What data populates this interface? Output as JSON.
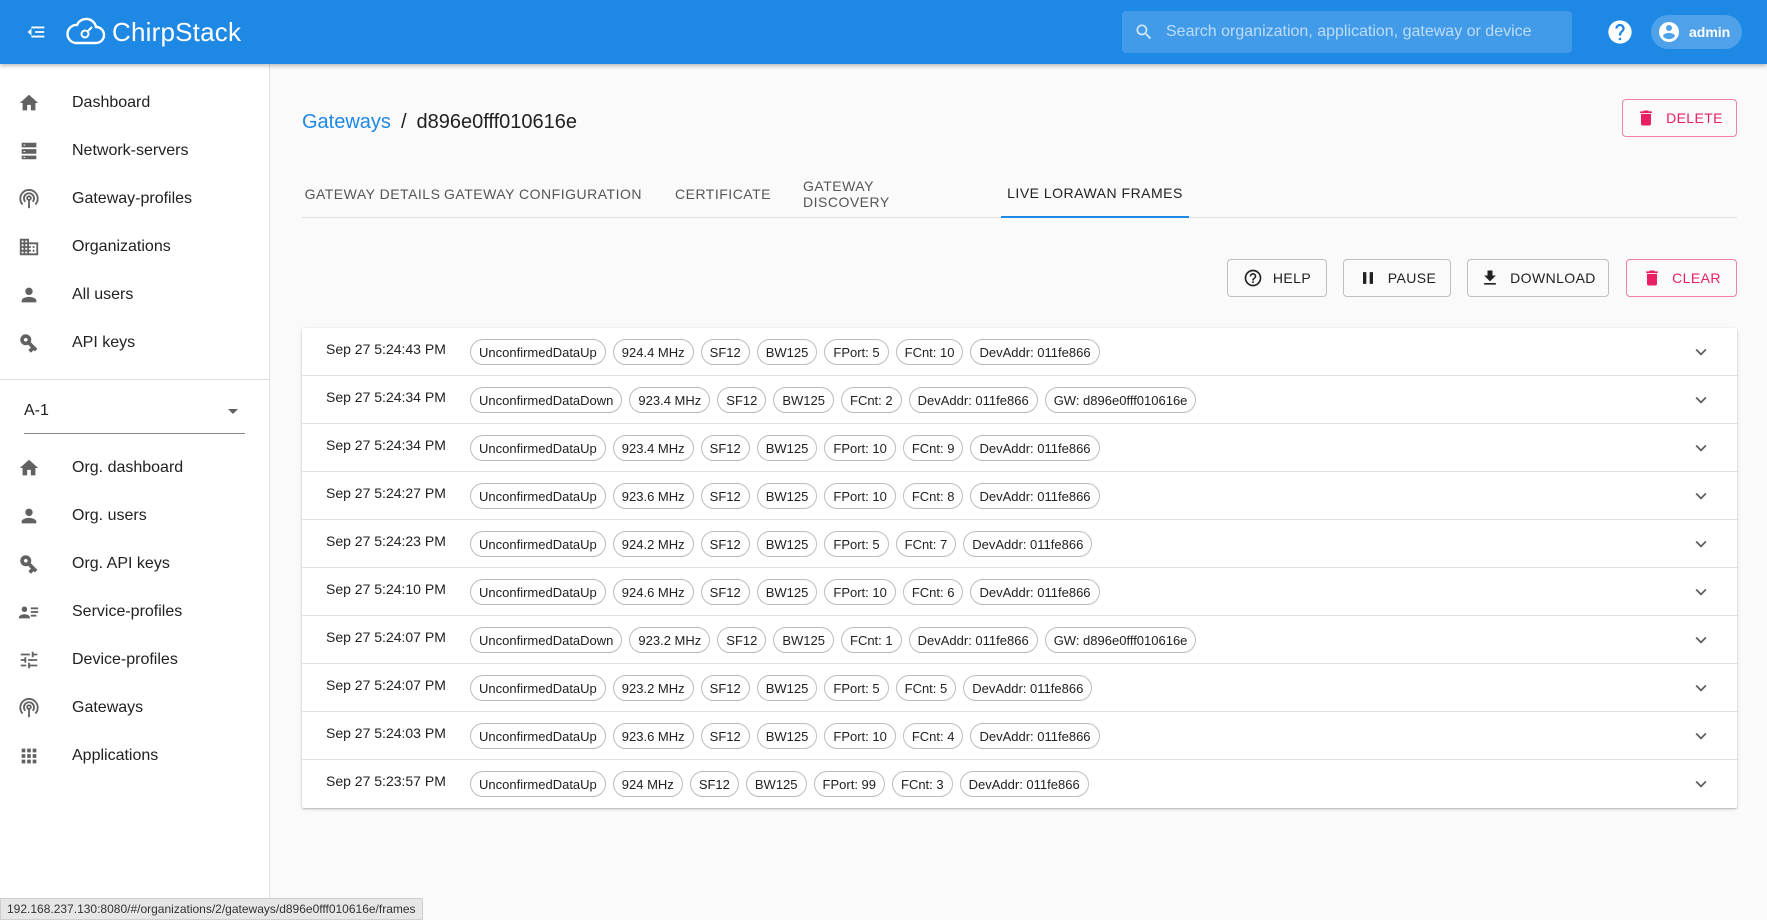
{
  "header": {
    "logo_text": "ChirpStack",
    "search_placeholder": "Search organization, application, gateway or device",
    "user_name": "admin"
  },
  "sidebar": {
    "global_items": [
      {
        "label": "Dashboard",
        "icon": "home-icon"
      },
      {
        "label": "Network-servers",
        "icon": "server-icon"
      },
      {
        "label": "Gateway-profiles",
        "icon": "radio-tower-icon"
      },
      {
        "label": "Organizations",
        "icon": "domain-icon"
      },
      {
        "label": "All users",
        "icon": "person-icon"
      },
      {
        "label": "API keys",
        "icon": "key-icon"
      }
    ],
    "org_selected": "A-1",
    "org_items": [
      {
        "label": "Org. dashboard",
        "icon": "home-icon"
      },
      {
        "label": "Org. users",
        "icon": "person-icon"
      },
      {
        "label": "Org. API keys",
        "icon": "key-icon"
      },
      {
        "label": "Service-profiles",
        "icon": "account-details-icon"
      },
      {
        "label": "Device-profiles",
        "icon": "tune-icon"
      },
      {
        "label": "Gateways",
        "icon": "radio-tower-icon"
      },
      {
        "label": "Applications",
        "icon": "apps-grid-icon"
      }
    ]
  },
  "breadcrumb": {
    "parent": "Gateways",
    "separator": "/",
    "current": "d896e0fff010616e"
  },
  "actions": {
    "delete": "DELETE",
    "help": "HELP",
    "pause": "PAUSE",
    "download": "DOWNLOAD",
    "clear": "CLEAR"
  },
  "tabs": [
    {
      "label": "GATEWAY DETAILS",
      "active": false
    },
    {
      "label": "GATEWAY CONFIGURATION",
      "active": false
    },
    {
      "label": "CERTIFICATE",
      "active": false
    },
    {
      "label": "GATEWAY DISCOVERY",
      "active": false
    },
    {
      "label": "LIVE LORAWAN FRAMES",
      "active": true
    }
  ],
  "frames": [
    {
      "time": "Sep 27 5:24:43 PM",
      "chips": [
        "UnconfirmedDataUp",
        "924.4 MHz",
        "SF12",
        "BW125",
        "FPort: 5",
        "FCnt: 10",
        "DevAddr: 011fe866"
      ]
    },
    {
      "time": "Sep 27 5:24:34 PM",
      "chips": [
        "UnconfirmedDataDown",
        "923.4 MHz",
        "SF12",
        "BW125",
        "FCnt: 2",
        "DevAddr: 011fe866",
        "GW: d896e0fff010616e"
      ]
    },
    {
      "time": "Sep 27 5:24:34 PM",
      "chips": [
        "UnconfirmedDataUp",
        "923.4 MHz",
        "SF12",
        "BW125",
        "FPort: 10",
        "FCnt: 9",
        "DevAddr: 011fe866"
      ]
    },
    {
      "time": "Sep 27 5:24:27 PM",
      "chips": [
        "UnconfirmedDataUp",
        "923.6 MHz",
        "SF12",
        "BW125",
        "FPort: 10",
        "FCnt: 8",
        "DevAddr: 011fe866"
      ]
    },
    {
      "time": "Sep 27 5:24:23 PM",
      "chips": [
        "UnconfirmedDataUp",
        "924.2 MHz",
        "SF12",
        "BW125",
        "FPort: 5",
        "FCnt: 7",
        "DevAddr: 011fe866"
      ]
    },
    {
      "time": "Sep 27 5:24:10 PM",
      "chips": [
        "UnconfirmedDataUp",
        "924.6 MHz",
        "SF12",
        "BW125",
        "FPort: 10",
        "FCnt: 6",
        "DevAddr: 011fe866"
      ]
    },
    {
      "time": "Sep 27 5:24:07 PM",
      "chips": [
        "UnconfirmedDataDown",
        "923.2 MHz",
        "SF12",
        "BW125",
        "FCnt: 1",
        "DevAddr: 011fe866",
        "GW: d896e0fff010616e"
      ]
    },
    {
      "time": "Sep 27 5:24:07 PM",
      "chips": [
        "UnconfirmedDataUp",
        "923.2 MHz",
        "SF12",
        "BW125",
        "FPort: 5",
        "FCnt: 5",
        "DevAddr: 011fe866"
      ]
    },
    {
      "time": "Sep 27 5:24:03 PM",
      "chips": [
        "UnconfirmedDataUp",
        "923.6 MHz",
        "SF12",
        "BW125",
        "FPort: 10",
        "FCnt: 4",
        "DevAddr: 011fe866"
      ]
    },
    {
      "time": "Sep 27 5:23:57 PM",
      "chips": [
        "UnconfirmedDataUp",
        "924 MHz",
        "SF12",
        "BW125",
        "FPort: 99",
        "FCnt: 3",
        "DevAddr: 011fe866"
      ]
    }
  ],
  "status_url": "192.168.237.130:8080/#/organizations/2/gateways/d896e0fff010616e/frames",
  "colors": {
    "primary": "#1e88e5",
    "danger": "#e91e63"
  }
}
